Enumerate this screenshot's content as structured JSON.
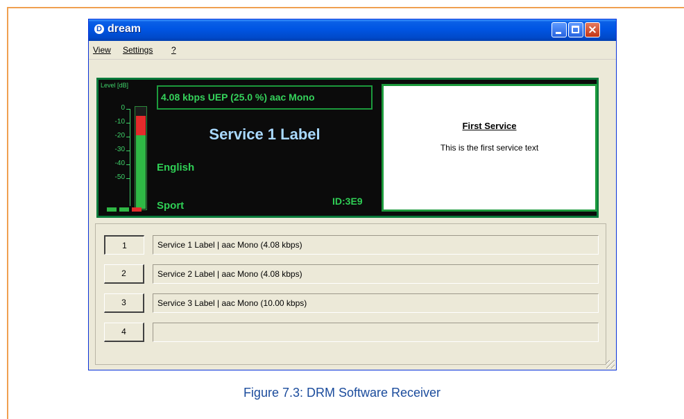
{
  "window": {
    "title": "dream",
    "icon": "dream-app-icon"
  },
  "menu": [
    {
      "label": "View"
    },
    {
      "label": "Settings"
    },
    {
      "label": "?"
    }
  ],
  "level_meter": {
    "label": "Level [dB]",
    "ticks": [
      "0",
      "-10",
      "-20",
      "-30",
      "-40",
      "-50"
    ],
    "level_fraction": 0.85,
    "peak_fraction": 0.92
  },
  "display": {
    "bitrate": "4.08 kbps UEP (25.0 %)  aac  Mono",
    "service_label": "Service 1 Label",
    "language": "English",
    "program_type": "Sport",
    "service_id": "ID:3E9"
  },
  "text_message": {
    "title": "First Service",
    "body": "This is the first service text"
  },
  "services": [
    {
      "number": "1",
      "description": "Service 1 Label  |   aac Mono (4.08 kbps)",
      "selected": true
    },
    {
      "number": "2",
      "description": "Service 2 Label  |   aac Mono (4.08 kbps)",
      "selected": false
    },
    {
      "number": "3",
      "description": "Service 3 Label  |   aac Mono (10.00 kbps)",
      "selected": false
    },
    {
      "number": "4",
      "description": "",
      "selected": false
    }
  ],
  "caption": "Figure 7.3: DRM Software Receiver",
  "colors": {
    "titlebar": "#0055e3",
    "display_bg": "#0b0b0b",
    "display_green": "#2fcf55",
    "service_label_blue": "#a9d9ff",
    "caption_blue": "#1a4b9c",
    "frame_orange": "#f0a050"
  }
}
